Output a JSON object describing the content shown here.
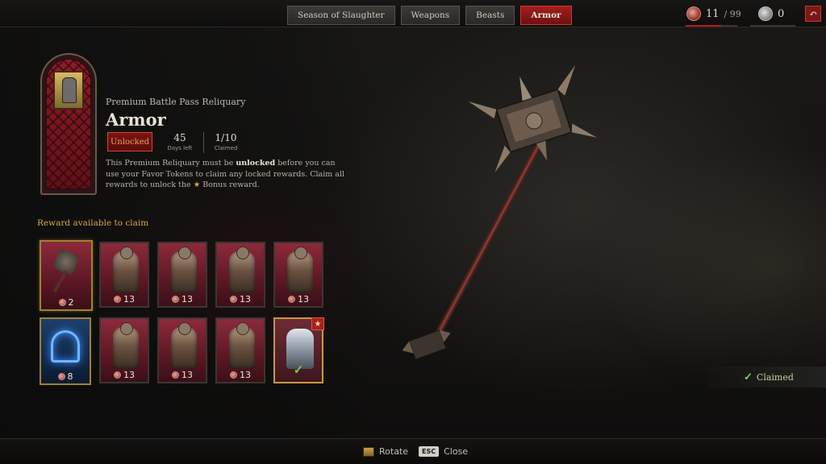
{
  "tabs": [
    {
      "label": "Season of Slaughter",
      "active": false
    },
    {
      "label": "Weapons",
      "active": false
    },
    {
      "label": "Beasts",
      "active": false
    },
    {
      "label": "Armor",
      "active": true
    }
  ],
  "currency": {
    "favor_tokens": "11",
    "favor_max": "/ 99",
    "platinum": "0",
    "back_icon": "↶"
  },
  "reliquary": {
    "subtitle": "Premium Battle Pass Reliquary",
    "title": "Armor",
    "status": "Unlocked",
    "days_left_value": "45",
    "days_left_label": "Days left",
    "claimed_value": "1/10",
    "claimed_label": "Claimed",
    "desc_part1": "This Premium Reliquary must be ",
    "desc_bold": "unlocked",
    "desc_part2": " before you can use your Favor Tokens to claim any locked rewards. Claim all rewards to unlock the ",
    "desc_star": "★",
    "desc_part3": " Bonus reward."
  },
  "rewards": {
    "header": "Reward available to claim",
    "row1": [
      {
        "kind": "mace-icon",
        "cost": "2"
      },
      {
        "kind": "armor-icon",
        "cost": "13"
      },
      {
        "kind": "armor-icon",
        "cost": "13"
      },
      {
        "kind": "armor-icon",
        "cost": "13"
      },
      {
        "kind": "armor-icon",
        "cost": "13"
      }
    ],
    "row2": [
      {
        "kind": "portal-icon",
        "cost": "8"
      },
      {
        "kind": "armor-icon",
        "cost": "13"
      },
      {
        "kind": "armor-icon",
        "cost": "13"
      },
      {
        "kind": "armor-icon",
        "cost": "13"
      },
      {
        "kind": "bonus-armor-icon",
        "cost": "✓"
      }
    ],
    "bonus_star": "★"
  },
  "preview": {
    "claimed_label": "Claimed",
    "claimed_check": "✓"
  },
  "footer": {
    "rotate_label": "Rotate",
    "close_key": "ESC",
    "close_label": "Close"
  },
  "colors": {
    "accent_red": "#a31e1e",
    "gold": "#d8a843",
    "claimed_green": "#6fd05a"
  }
}
